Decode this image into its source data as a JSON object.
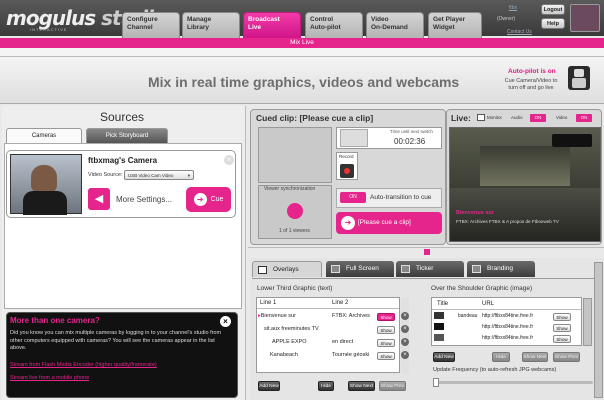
{
  "brand": {
    "logo_main": "mogulus",
    "logo_studio": "studio",
    "logo_sub": "INTERACTIVE"
  },
  "nav": {
    "tabs": [
      {
        "label_1": "Configure",
        "label_2": "Channel"
      },
      {
        "label_1": "Manage",
        "label_2": "Library"
      },
      {
        "label_1": "Broadcast",
        "label_2": "Live"
      },
      {
        "label_1": "Control",
        "label_2": "Auto-pilot"
      },
      {
        "label_1": "Video",
        "label_2": "On-Demand"
      },
      {
        "label_1": "Get Player",
        "label_2": "Widget"
      }
    ]
  },
  "header": {
    "user_link": "ftbx",
    "user_role": "(Owner)",
    "logout": "Logout",
    "help": "Help",
    "contact": "Contact Us"
  },
  "subnav": {
    "label": "Mix Live"
  },
  "banner": {
    "title": "Mix in real time graphics, videos and webcams",
    "autopilot_title": "Auto-pilot is on",
    "autopilot_sub": "Cue Camera/Video to turn off and go live"
  },
  "sources": {
    "title": "Sources",
    "tabs": [
      "Cameras",
      "Pick Storyboard"
    ],
    "camera": {
      "name": "ftbxmag's Camera",
      "video_source_label": "Video Source:",
      "video_source_value": "USB Video Cam Video",
      "more_settings": "More Settings...",
      "cue": "Cue"
    },
    "more_cameras": {
      "title": "More than one camera?",
      "body": "Did you know you can mix multiple cameras by logging in to your channel's studio from other computers equipped with cameras? You will see the cameras appear in the list above.",
      "link1": "Stream from Flash Media Encoder (higher quality/framerate)",
      "link2": "Stream live from a mobile phone"
    }
  },
  "cued": {
    "title": "Cued clip: [Please cue a clip]",
    "time_label": "Time until next switch",
    "time": "00:02:36",
    "viewer_sync": "Viewer synchronization",
    "viewers": "1 of 1 viewers",
    "record": "Record",
    "toggle_on": "ON",
    "auto_transition": "Auto-transition to cue",
    "cue_button": "[Please cue a clip]"
  },
  "live": {
    "title": "Live:",
    "monitor": "Monitor",
    "audio": "Audio",
    "audio_state": "ON",
    "video": "Video",
    "video_state": "ON",
    "caption_1": "Bienvenue sur",
    "caption_2": "FTBX: Archives FTBX & A propos de Ftboxweb TV"
  },
  "overlays": {
    "tabs": [
      "Overlays",
      "Full Screen",
      "Ticker",
      "Branding"
    ],
    "lower_third": {
      "title": "Lower Third Graphic (text)",
      "col1": "Line 1",
      "col2": "Line 2",
      "rows": [
        {
          "line1": "Bienvenue sur",
          "line2": "FTBX: Archives"
        },
        {
          "line1": "sit.aux freeminutes TV",
          "line2": ""
        },
        {
          "line1": "APPLE EXPO",
          "line2": "en direct"
        },
        {
          "line1": "Kanabeach",
          "line2": "Tournée géoski"
        }
      ],
      "show": "Show",
      "add_new": "Add New",
      "hide": "Hide",
      "show_next": "Show Next",
      "show_prev": "Show Prev"
    },
    "shoulder": {
      "title": "Over the Shoulder Graphic (image)",
      "col_title": "Title",
      "col_url": "URL",
      "rows": [
        {
          "title": "bandeau",
          "url": "http://ftbxx84tine.free.fr"
        },
        {
          "title": "",
          "url": "http://ftbxx84tine.free.fr"
        },
        {
          "title": "",
          "url": "http://ftbxx84tine.free.fr"
        }
      ],
      "show": "Show",
      "add_new": "Add New",
      "hide": "Hide",
      "show_next": "Show Next",
      "show_prev": "Show Prev",
      "update_freq": "Update Frequency (to auto-refresh JPG webcams)"
    }
  },
  "colors": {
    "accent": "#e5248c",
    "dark": "#3a3a3a"
  }
}
